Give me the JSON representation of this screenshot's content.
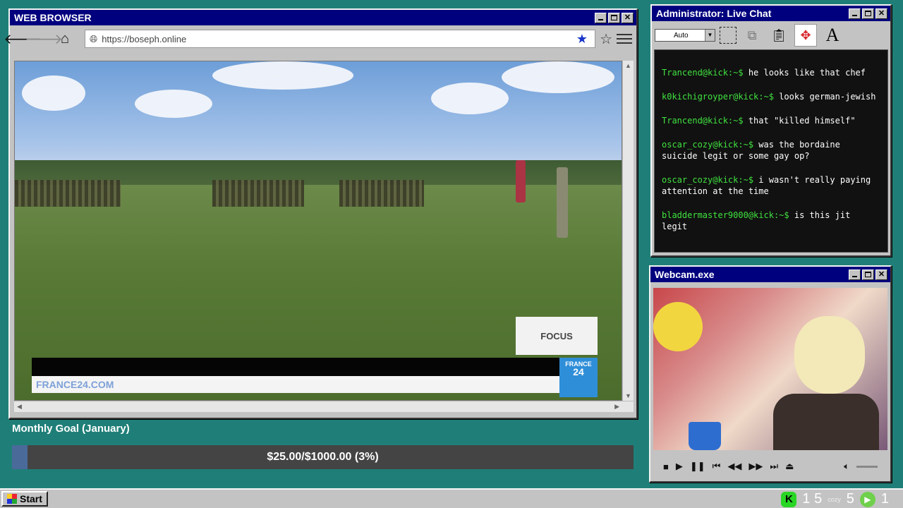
{
  "browser": {
    "title": "WEB BROWSER",
    "url": "https://boseph.online",
    "video": {
      "focus_label": "FOCUS",
      "ticker_site": "FRANCE24.COM",
      "logo_line1": "FRANCE",
      "logo_line2": "24"
    }
  },
  "goal": {
    "title": "Monthly Goal (January)",
    "progress_text": "$25.00/$1000.00 (3%)",
    "fraction": 0.025
  },
  "chat": {
    "title": "Administrator: Live Chat",
    "size_select": "Auto",
    "messages": [
      {
        "user": "Trancend@kick:~$",
        "text": "he looks like that chef"
      },
      {
        "user": "k0kichigroyper@kick:~$",
        "text": "looks german-jewish"
      },
      {
        "user": "Trancend@kick:~$",
        "text": "that \"killed himself\""
      },
      {
        "user": "oscar_cozy@kick:~$",
        "text": "was the bordaine suicide legit or some gay op?"
      },
      {
        "user": "oscar_cozy@kick:~$",
        "text": "i wasn't really paying attention at the time"
      },
      {
        "user": "bladdermaster9000@kick:~$",
        "text": "is this jit legit"
      }
    ]
  },
  "webcam": {
    "title": "Webcam.exe"
  },
  "taskbar": {
    "start_label": "Start",
    "tray_count_1": "1 5",
    "tray_cozy": "cozy",
    "tray_count_2": "5",
    "tray_count_3": "1"
  },
  "colors": {
    "desktop": "#1f7f78",
    "titlebar": "#00007e",
    "chat_username": "#3fe23f"
  }
}
